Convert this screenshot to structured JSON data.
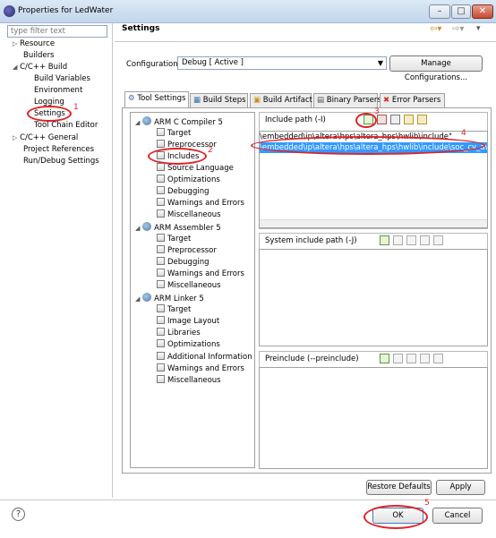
{
  "window": {
    "title": "Properties for LedWater"
  },
  "filter": {
    "placeholder": "type filter text"
  },
  "nav": {
    "resource": "Resource",
    "builders": "Builders",
    "ccpp_build": "C/C++ Build",
    "build_variables": "Build Variables",
    "environment": "Environment",
    "logging": "Logging",
    "settings": "Settings",
    "tool_chain_editor": "Tool Chain Editor",
    "ccpp_general": "C/C++ General",
    "project_references": "Project References",
    "run_debug": "Run/Debug Settings"
  },
  "header": {
    "title": "Settings"
  },
  "configuration": {
    "label": "Configuration:",
    "value": "Debug  [ Active ]",
    "manage_label": "Manage Configurations..."
  },
  "tabs": [
    "Tool Settings",
    "Build Steps",
    "Build Artifact",
    "Binary Parsers",
    "Error Parsers"
  ],
  "tree": {
    "compiler": {
      "label": "ARM C Compiler 5",
      "items": [
        "Target",
        "Preprocessor",
        "Includes",
        "Source Language",
        "Optimizations",
        "Debugging",
        "Warnings and Errors",
        "Miscellaneous"
      ]
    },
    "assembler": {
      "label": "ARM Assembler 5",
      "items": [
        "Target",
        "Preprocessor",
        "Debugging",
        "Warnings and Errors",
        "Miscellaneous"
      ]
    },
    "linker": {
      "label": "ARM Linker 5",
      "items": [
        "Target",
        "Image Layout",
        "Libraries",
        "Optimizations",
        "Additional Information",
        "Warnings and Errors",
        "Miscellaneous"
      ]
    }
  },
  "include_path": {
    "title": "Include path (-I)",
    "entries": [
      "\\embedded\\ip\\altera\\hps\\altera_hps\\hwlib\\include\"",
      "\\embedded\\ip\\altera\\hps\\altera_hps\\hwlib\\include\\soc_cv_av\""
    ]
  },
  "system_include": {
    "title": "System include path (-J)"
  },
  "preinclude": {
    "title": "Preinclude (--preinclude)"
  },
  "buttons": {
    "restore_defaults": "Restore Defaults",
    "apply": "Apply",
    "ok": "OK",
    "cancel": "Cancel"
  },
  "annotations": [
    "1",
    "2",
    "3",
    "4",
    "5"
  ],
  "colors": {
    "annotation": "#e0232a",
    "selection": "#3399ff"
  }
}
